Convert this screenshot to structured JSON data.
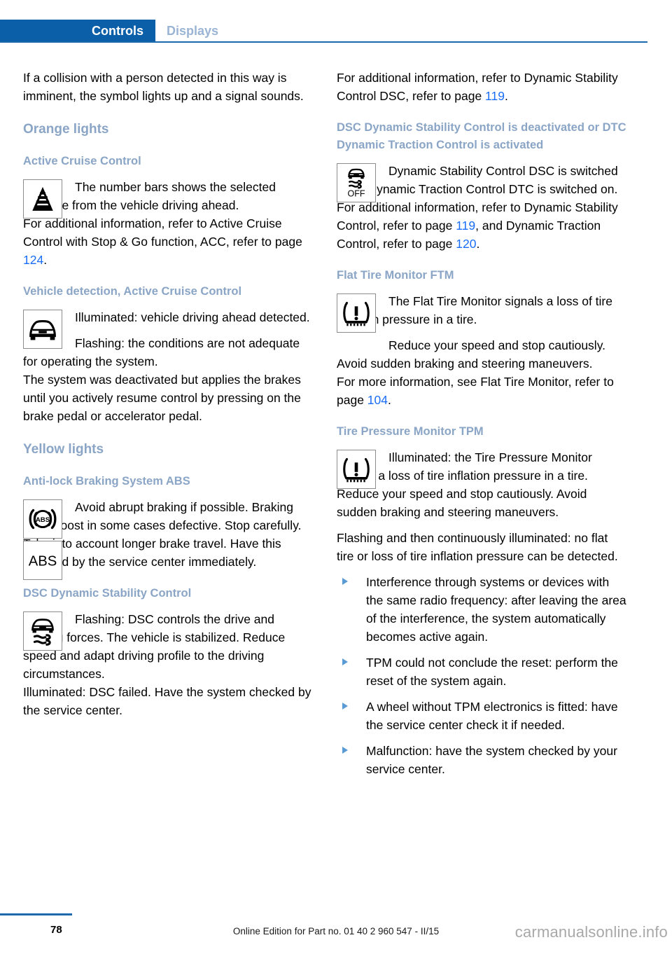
{
  "header": {
    "active_tab": "Controls",
    "inactive_tab": "Displays"
  },
  "left_column": {
    "intro_paragraph": "If a collision with a person detected in this way is imminent, the symbol lights up and a signal sounds.",
    "orange_lights_heading": "Orange lights",
    "acc": {
      "heading": "Active Cruise Control",
      "icon_name": "distance-bars-icon",
      "body": "The number bars shows the selected distance from the vehicle driving ahead.",
      "reference_prefix": "For additional information, refer to Active Cruise Control with Stop & Go function, ACC, refer to page ",
      "reference_page": "124",
      "reference_suffix": "."
    },
    "vehicle_detection": {
      "heading": "Vehicle detection, Active Cruise Control",
      "icon_name": "car-front-icon",
      "illuminated": "Illuminated: vehicle driving ahead detected.",
      "flashing": "Flashing: the conditions are not adequate for operating the system.",
      "note": "The system was deactivated but applies the brakes until you actively resume control by pressing on the brake pedal or accelerator pedal."
    },
    "yellow_lights_heading": "Yellow lights",
    "abs": {
      "heading": "Anti-lock Braking System ABS",
      "icon_name_1": "abs-ring-icon",
      "icon_name_2": "abs-text-icon",
      "icon_2_label": "ABS",
      "body": "Avoid abrupt braking if possible. Braking force boost in some cases defective. Stop carefully. Take into account longer brake travel. Have this checked by the service center immediately."
    },
    "dsc": {
      "heading": "DSC Dynamic Stability Control",
      "icon_name": "dsc-skid-icon",
      "flashing": "Flashing: DSC controls the drive and braking forces. The vehicle is stabilized. Reduce speed and adapt driving profile to the driving circumstances.",
      "illuminated": "Illuminated: DSC failed. Have the system checked by the service center."
    }
  },
  "right_column": {
    "dsc_reference_prefix": "For additional information, refer to Dynamic Stability Control DSC, refer to page ",
    "dsc_reference_page": "119",
    "dsc_reference_suffix": ".",
    "dsc_off": {
      "heading": "DSC Dynamic Stability Control is deactivated or DTC Dynamic Traction Control is activated",
      "icon_name": "dsc-off-icon",
      "icon_label": "OFF",
      "body": "Dynamic Stability Control DSC is switched off or Dynamic Traction Control DTC is switched on.",
      "reference_prefix": "For additional information, refer to Dynamic Stability Control, refer to page ",
      "reference_page_1": "119",
      "reference_middle": ", and Dynamic Traction Control, refer to page ",
      "reference_page_2": "120",
      "reference_suffix": "."
    },
    "ftm": {
      "heading": "Flat Tire Monitor FTM",
      "icon_name": "tire-pressure-warning-icon",
      "body": "The Flat Tire Monitor signals a loss of tire inflation pressure in a tire.",
      "reduce": "Reduce your speed and stop cautiously. Avoid sudden braking and steering maneuvers.",
      "reference_prefix": "For more information, see Flat Tire Monitor, refer to page ",
      "reference_page": "104",
      "reference_suffix": "."
    },
    "tpm": {
      "heading": "Tire Pressure Monitor TPM",
      "icon_name": "tire-pressure-warning-icon",
      "illuminated": "Illuminated: the Tire Pressure Monitor signals a loss of tire inflation pressure in a tire.",
      "reduce": "Reduce your speed and stop cautiously. Avoid sudden braking and steering maneuvers.",
      "flashing": "Flashing and then continuously illuminated: no flat tire or loss of tire inflation pressure can be detected.",
      "bullets": [
        "Interference through systems or devices with the same radio frequency: after leaving the area of the interference, the system automatically becomes active again.",
        "TPM could not conclude the reset: perform the reset of the system again.",
        "A wheel without TPM electronics is fitted: have the service center check it if needed.",
        "Malfunction: have the system checked by your service center."
      ]
    }
  },
  "footer": {
    "page_number": "78",
    "edition": "Online Edition for Part no. 01 40 2 960 547 - II/15",
    "watermark": "carmanualsonline.info"
  },
  "colors": {
    "tab_active_bg": "#0b5ea8",
    "tab_inactive_text": "#9ab4d4",
    "heading": "#8aa5c6",
    "link": "#1a6ef5",
    "rule": "#1d69ae",
    "bullet": "#5b9bd5"
  }
}
